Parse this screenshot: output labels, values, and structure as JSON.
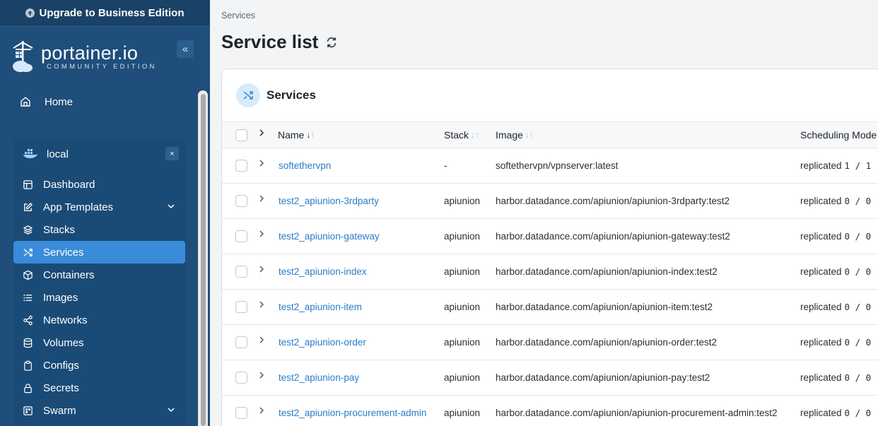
{
  "sidebar": {
    "upgrade_label": "Upgrade to Business Edition",
    "logo": {
      "main": "portainer.io",
      "sub": "COMMUNITY EDITION"
    },
    "collapse_glyph": "«",
    "home_label": "Home",
    "environment": {
      "name": "local",
      "close_glyph": "×"
    },
    "menu": [
      {
        "label": "Dashboard",
        "icon": "dashboard-icon"
      },
      {
        "label": "App Templates",
        "icon": "edit-icon",
        "has_chevron": true
      },
      {
        "label": "Stacks",
        "icon": "layers-icon"
      },
      {
        "label": "Services",
        "icon": "shuffle-icon",
        "active": true
      },
      {
        "label": "Containers",
        "icon": "box-icon"
      },
      {
        "label": "Images",
        "icon": "list-icon"
      },
      {
        "label": "Networks",
        "icon": "share-icon"
      },
      {
        "label": "Volumes",
        "icon": "database-icon"
      },
      {
        "label": "Configs",
        "icon": "clipboard-icon"
      },
      {
        "label": "Secrets",
        "icon": "lock-icon"
      },
      {
        "label": "Swarm",
        "icon": "grid-icon",
        "has_chevron": true
      }
    ]
  },
  "main": {
    "breadcrumb": "Services",
    "page_title": "Service list",
    "card_title": "Services",
    "columns": {
      "name": "Name",
      "stack": "Stack",
      "image": "Image",
      "mode": "Scheduling Mode"
    },
    "rows": [
      {
        "name": "softethervpn",
        "stack": "-",
        "image": "softethervpn/vpnserver:latest",
        "mode": "replicated",
        "replicas": "1 / 1"
      },
      {
        "name": "test2_apiunion-3rdparty",
        "stack": "apiunion",
        "image": "harbor.datadance.com/apiunion/apiunion-3rdparty:test2",
        "mode": "replicated",
        "replicas": "0 / 0"
      },
      {
        "name": "test2_apiunion-gateway",
        "stack": "apiunion",
        "image": "harbor.datadance.com/apiunion/apiunion-gateway:test2",
        "mode": "replicated",
        "replicas": "0 / 0"
      },
      {
        "name": "test2_apiunion-index",
        "stack": "apiunion",
        "image": "harbor.datadance.com/apiunion/apiunion-index:test2",
        "mode": "replicated",
        "replicas": "0 / 0"
      },
      {
        "name": "test2_apiunion-item",
        "stack": "apiunion",
        "image": "harbor.datadance.com/apiunion/apiunion-item:test2",
        "mode": "replicated",
        "replicas": "0 / 0"
      },
      {
        "name": "test2_apiunion-order",
        "stack": "apiunion",
        "image": "harbor.datadance.com/apiunion/apiunion-order:test2",
        "mode": "replicated",
        "replicas": "0 / 0"
      },
      {
        "name": "test2_apiunion-pay",
        "stack": "apiunion",
        "image": "harbor.datadance.com/apiunion/apiunion-pay:test2",
        "mode": "replicated",
        "replicas": "0 / 0"
      },
      {
        "name": "test2_apiunion-procurement-admin",
        "stack": "apiunion",
        "image": "harbor.datadance.com/apiunion/apiunion-procurement-admin:test2",
        "mode": "replicated",
        "replicas": "0 / 0"
      }
    ]
  },
  "colors": {
    "sidebar_bg": "#1f4e7a",
    "active_item": "#3a8bd8",
    "link": "#2b7cc8"
  }
}
